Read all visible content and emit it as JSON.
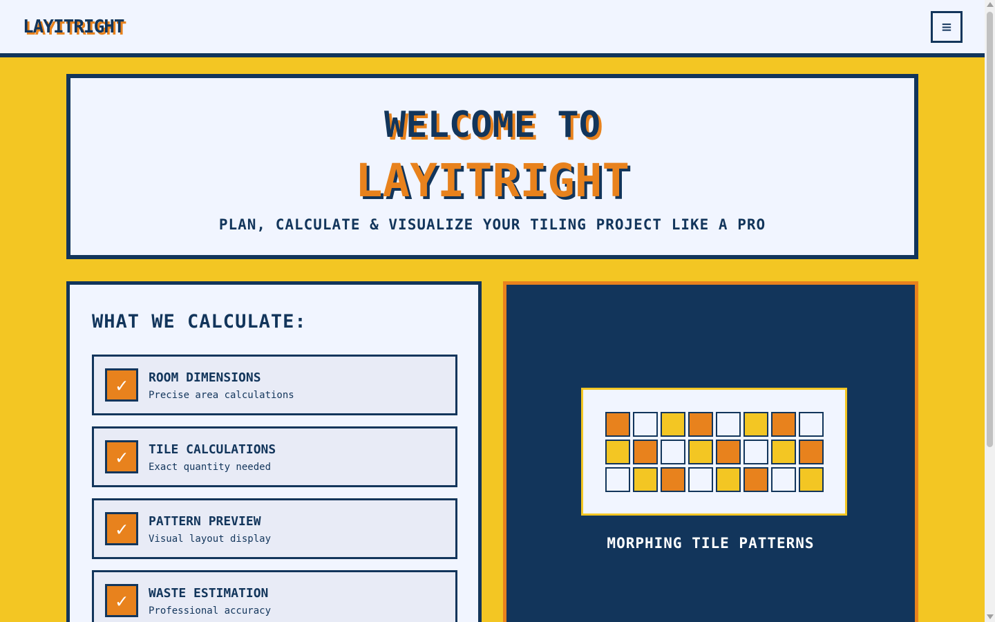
{
  "header": {
    "logo": "LAYITRIGHT",
    "menu_icon": "≡"
  },
  "hero": {
    "line1": "WELCOME TO",
    "line2": "LAYITRIGHT",
    "subtitle": "PLAN, CALCULATE & VISUALIZE YOUR TILING PROJECT LIKE A PRO"
  },
  "calculate": {
    "title": "WHAT WE CALCULATE:",
    "check_icon": "✓",
    "features": [
      {
        "title": "ROOM DIMENSIONS",
        "desc": "Precise area calculations"
      },
      {
        "title": "TILE CALCULATIONS",
        "desc": "Exact quantity needed"
      },
      {
        "title": "PATTERN PREVIEW",
        "desc": "Visual layout display"
      },
      {
        "title": "WASTE ESTIMATION",
        "desc": "Professional accuracy"
      }
    ]
  },
  "pattern": {
    "caption": "MORPHING TILE PATTERNS",
    "tile_rows": [
      [
        "o",
        "w",
        "y",
        "o",
        "w",
        "y",
        "o",
        "w"
      ],
      [
        "y",
        "o",
        "w",
        "y",
        "o",
        "w",
        "y",
        "o"
      ],
      [
        "w",
        "y",
        "o",
        "w",
        "y",
        "o",
        "w",
        "y"
      ]
    ]
  },
  "colors": {
    "navy": "#12355b",
    "orange": "#e8821d",
    "yellow": "#f3c623",
    "offwhite": "#f1f5ff"
  }
}
